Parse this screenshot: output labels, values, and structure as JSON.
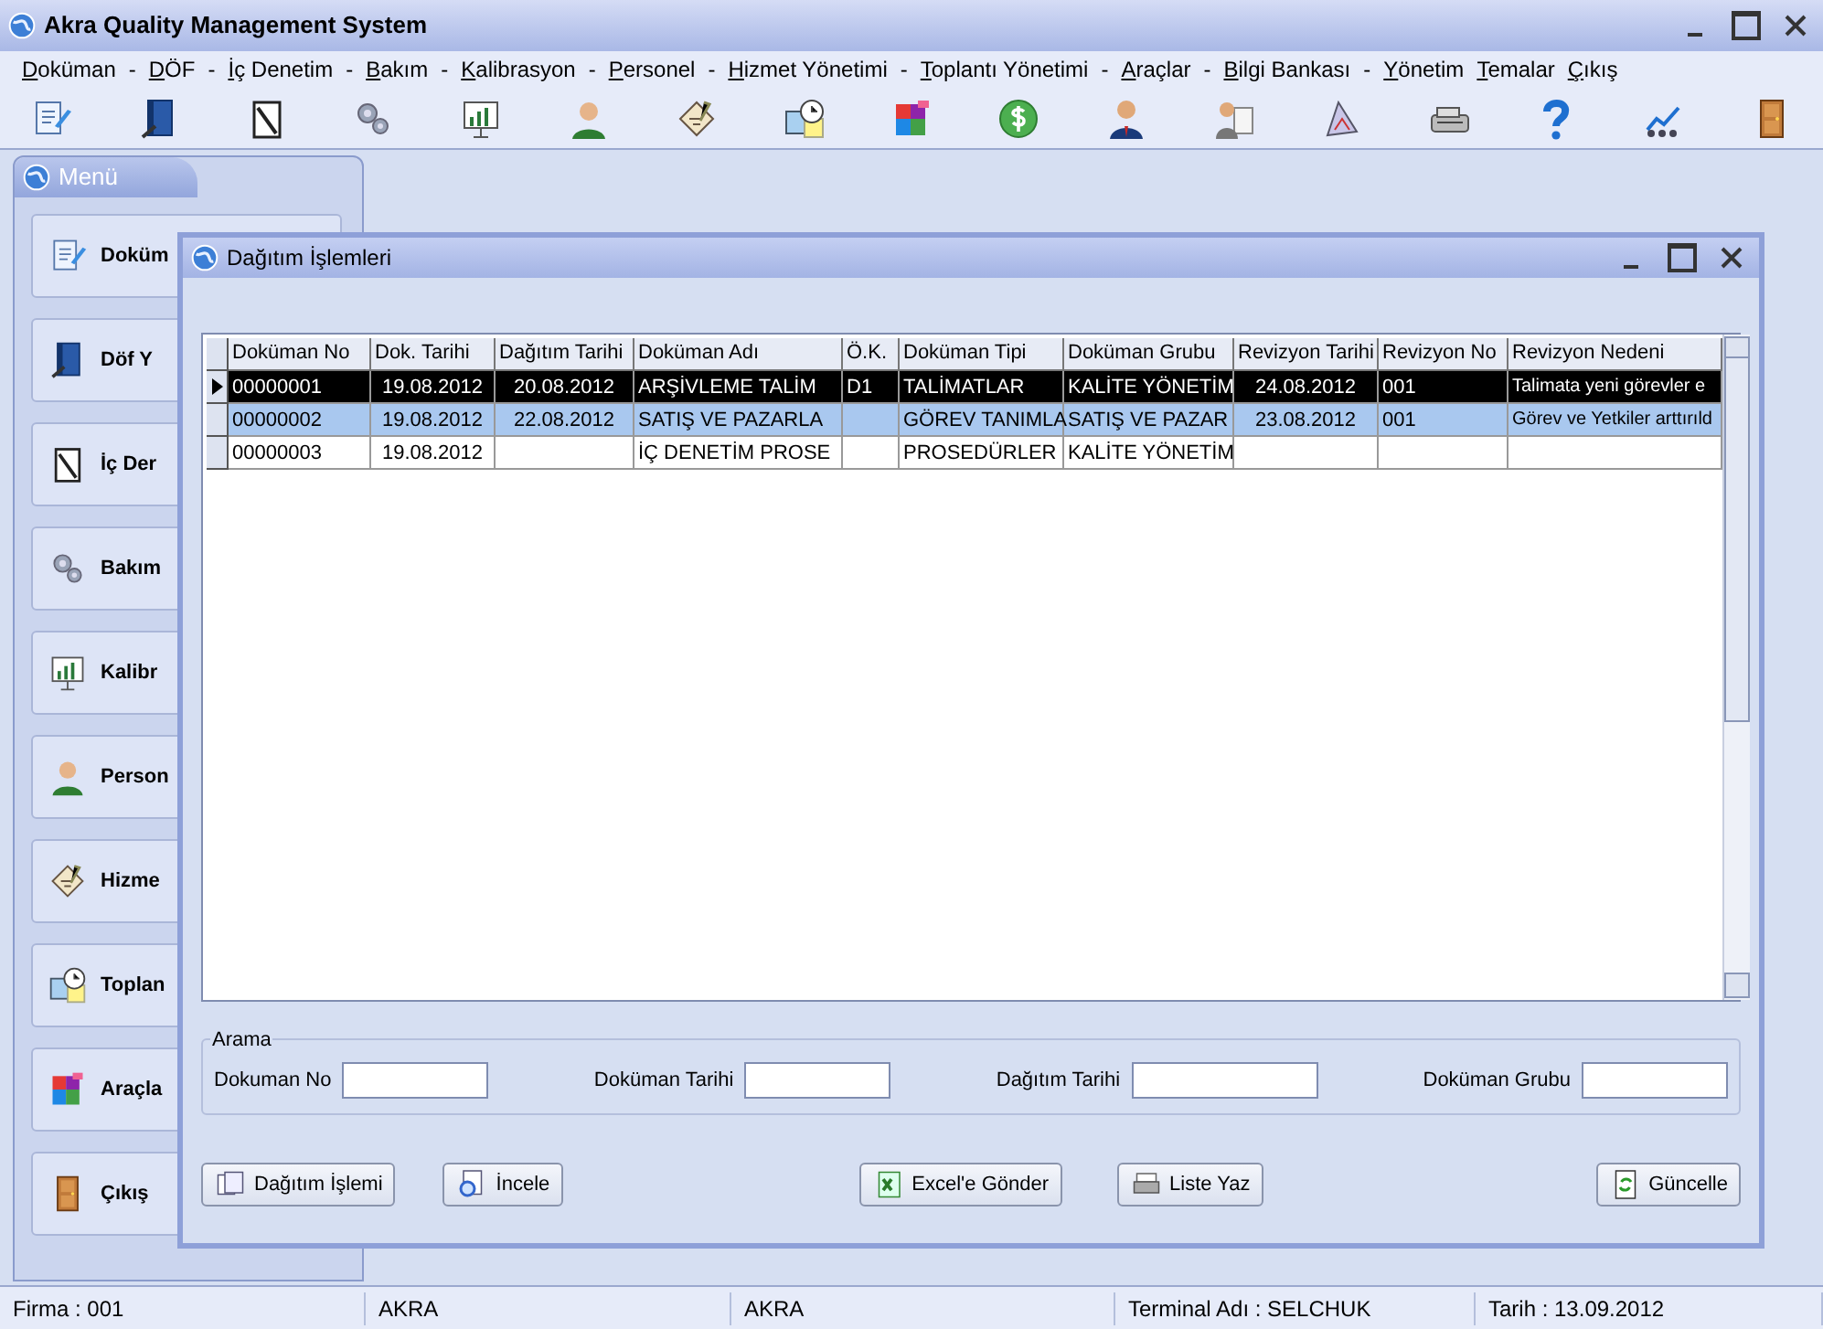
{
  "window": {
    "title": "Akra Quality Management System"
  },
  "menu": [
    {
      "kind": "item",
      "label": "Doküman"
    },
    {
      "kind": "separator",
      "label": "-"
    },
    {
      "kind": "item",
      "label": "DÖF"
    },
    {
      "kind": "separator",
      "label": "-"
    },
    {
      "kind": "item",
      "label": "İç Denetim"
    },
    {
      "kind": "separator",
      "label": "-"
    },
    {
      "kind": "item",
      "label": "Bakım"
    },
    {
      "kind": "separator",
      "label": "-"
    },
    {
      "kind": "item",
      "label": "Kalibrasyon"
    },
    {
      "kind": "separator",
      "label": "-"
    },
    {
      "kind": "item",
      "label": "Personel"
    },
    {
      "kind": "separator",
      "label": "-"
    },
    {
      "kind": "item",
      "label": "Hizmet Yönetimi"
    },
    {
      "kind": "separator",
      "label": "-"
    },
    {
      "kind": "item",
      "label": "Toplantı Yönetimi"
    },
    {
      "kind": "separator",
      "label": "-"
    },
    {
      "kind": "item",
      "label": "Araçlar"
    },
    {
      "kind": "separator",
      "label": "-"
    },
    {
      "kind": "item",
      "label": "Bilgi Bankası"
    },
    {
      "kind": "separator",
      "label": "-"
    },
    {
      "kind": "item",
      "label": "Yönetim"
    },
    {
      "kind": "item",
      "label": "Temalar"
    },
    {
      "kind": "item",
      "label": "Çıkış"
    }
  ],
  "sidebar": {
    "title": "Menü",
    "items": [
      {
        "label": "Doküm"
      },
      {
        "label": "Döf Y"
      },
      {
        "label": "İç Der"
      },
      {
        "label": "Bakım"
      },
      {
        "label": "Kalibr"
      },
      {
        "label": "Person"
      },
      {
        "label": "Hizme"
      },
      {
        "label": "Toplan"
      },
      {
        "label": "Araçla"
      },
      {
        "label": "Çıkış"
      }
    ]
  },
  "child_window": {
    "title": "Dağıtım İşlemleri",
    "table": {
      "columns": [
        "Doküman No",
        "Dok. Tarihi",
        "Dağıtım Tarihi",
        "Doküman Adı",
        "Ö.K.",
        "Doküman Tipi",
        "Doküman Grubu",
        "Revizyon Tarihi",
        "Revizyon No",
        "Revizyon Nedeni"
      ],
      "rows": [
        {
          "focused": true,
          "selected": true,
          "cells": [
            "00000001",
            "19.08.2012",
            "20.08.2012",
            "ARŞİVLEME TALİM",
            "D1",
            "TALİMATLAR",
            "KALİTE YÖNETİM",
            "24.08.2012",
            "001",
            "Talimata yeni görevler e"
          ]
        },
        {
          "focused": false,
          "selected": true,
          "cells": [
            "00000002",
            "19.08.2012",
            "22.08.2012",
            "SATIŞ VE PAZARLA",
            "",
            "GÖREV TANIMLA",
            "SATIŞ VE PAZAR",
            "23.08.2012",
            "001",
            "Görev ve Yetkiler arttırıld"
          ]
        },
        {
          "focused": false,
          "selected": false,
          "cells": [
            "00000003",
            "19.08.2012",
            "",
            "İÇ DENETİM PROSE",
            "",
            "PROSEDÜRLER",
            "KALİTE YÖNETİM",
            "",
            "",
            ""
          ]
        }
      ]
    },
    "search": {
      "title": "Arama",
      "fields": [
        {
          "label": "Dokuman No"
        },
        {
          "label": "Doküman Tarihi"
        },
        {
          "label": "Dağıtım Tarihi"
        },
        {
          "label": "Doküman Grubu"
        }
      ]
    },
    "buttons": [
      "Dağıtım İşlemi",
      "İncele",
      "Excel'e Gönder",
      "Liste Yaz",
      "Güncelle"
    ]
  },
  "status_bar": [
    "Firma : 001",
    "AKRA",
    "AKRA",
    "Terminal Adı : SELCHUK",
    "Tarih : 13.09.2012"
  ]
}
